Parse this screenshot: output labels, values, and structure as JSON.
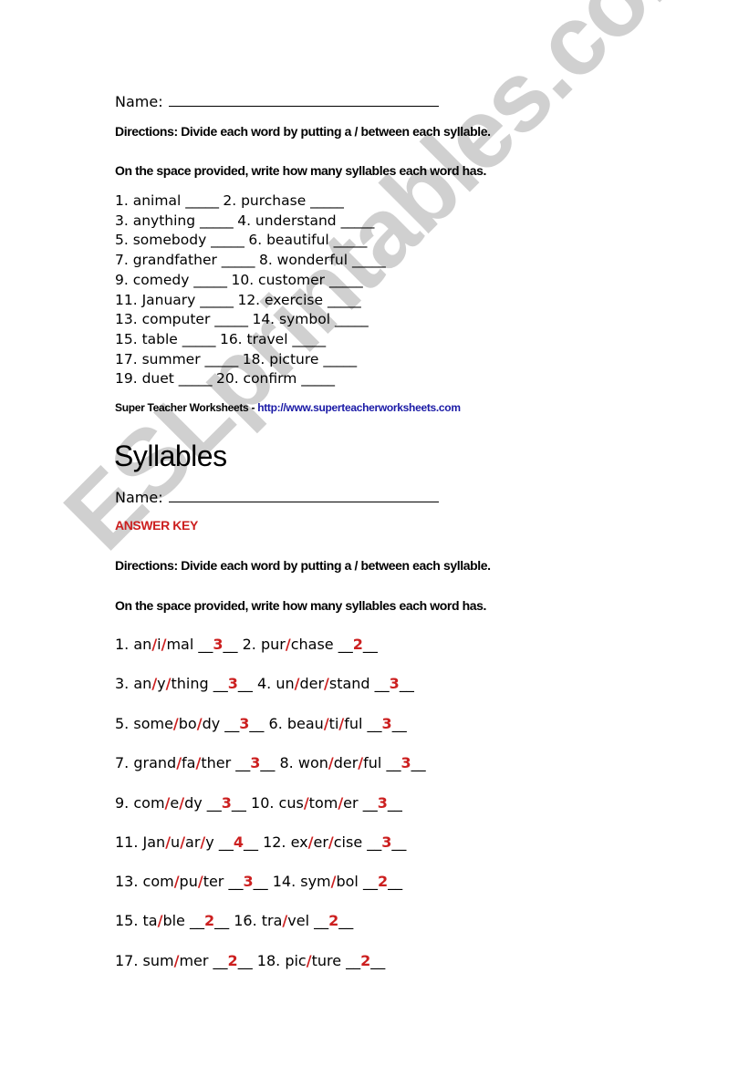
{
  "worksheet": {
    "name_label": "Name:",
    "directions_1": "Directions: Divide each word by putting a / between each syllable.",
    "directions_2": "On the space provided, write how many syllables each word has.",
    "blank": "_____",
    "rows": [
      [
        "1. animal",
        "2. purchase"
      ],
      [
        "3. anything",
        "4. understand"
      ],
      [
        "5. somebody",
        "6. beautiful"
      ],
      [
        "7. grandfather",
        "8. wonderful"
      ],
      [
        "9. comedy",
        "10. customer"
      ],
      [
        "11. January",
        "12. exercise"
      ],
      [
        "13. computer",
        "14. symbol"
      ],
      [
        "15. table",
        "16. travel"
      ],
      [
        "17. summer",
        "18. picture"
      ],
      [
        "19. duet",
        "20. confirm"
      ]
    ],
    "credit_text": "Super Teacher Worksheets - ",
    "credit_link": "http://www.superteacherworksheets.com"
  },
  "answer_key": {
    "title": "Syllables",
    "name_label": "Name:",
    "label": "ANSWER KEY",
    "directions_1": "Directions: Divide each word by putting a / between each syllable.",
    "directions_2": "On the space provided, write how many syllables each word has.",
    "items": [
      {
        "n": "1.",
        "syllables": [
          "an",
          "i",
          "mal"
        ],
        "count": "3"
      },
      {
        "n": "2.",
        "syllables": [
          "pur",
          "chase"
        ],
        "count": "2"
      },
      {
        "n": "3.",
        "syllables": [
          "an",
          "y",
          "thing"
        ],
        "count": "3"
      },
      {
        "n": "4.",
        "syllables": [
          "un",
          "der",
          "stand"
        ],
        "count": "3"
      },
      {
        "n": "5.",
        "syllables": [
          "some",
          "bo",
          "dy"
        ],
        "count": "3"
      },
      {
        "n": "6.",
        "syllables": [
          "beau",
          "ti",
          "ful"
        ],
        "count": "3"
      },
      {
        "n": "7.",
        "syllables": [
          "grand",
          "fa",
          "ther"
        ],
        "count": "3"
      },
      {
        "n": "8.",
        "syllables": [
          "won",
          "der",
          "ful"
        ],
        "count": "3"
      },
      {
        "n": "9.",
        "syllables": [
          "com",
          "e",
          "dy"
        ],
        "count": "3"
      },
      {
        "n": "10.",
        "syllables": [
          "cus",
          "tom",
          "er"
        ],
        "count": "3"
      },
      {
        "n": "11.",
        "syllables": [
          "Jan",
          "u",
          "ar",
          "y"
        ],
        "count": "4"
      },
      {
        "n": "12.",
        "syllables": [
          "ex",
          "er",
          "cise"
        ],
        "count": "3"
      },
      {
        "n": "13.",
        "syllables": [
          "com",
          "pu",
          "ter"
        ],
        "count": "3"
      },
      {
        "n": "14.",
        "syllables": [
          "sym",
          "bol"
        ],
        "count": "2"
      },
      {
        "n": "15.",
        "syllables": [
          "ta",
          "ble"
        ],
        "count": "2"
      },
      {
        "n": "16.",
        "syllables": [
          "tra",
          "vel"
        ],
        "count": "2"
      },
      {
        "n": "17.",
        "syllables": [
          "sum",
          "mer"
        ],
        "count": "2"
      },
      {
        "n": "18.",
        "syllables": [
          "pic",
          "ture"
        ],
        "count": "2"
      }
    ],
    "underscore": "__"
  },
  "watermark": "ESLprintables.com",
  "colors": {
    "answer_red": "#cc1f1f",
    "link_blue": "#1a1aa6",
    "watermark_gray": "#c8c8c8"
  }
}
